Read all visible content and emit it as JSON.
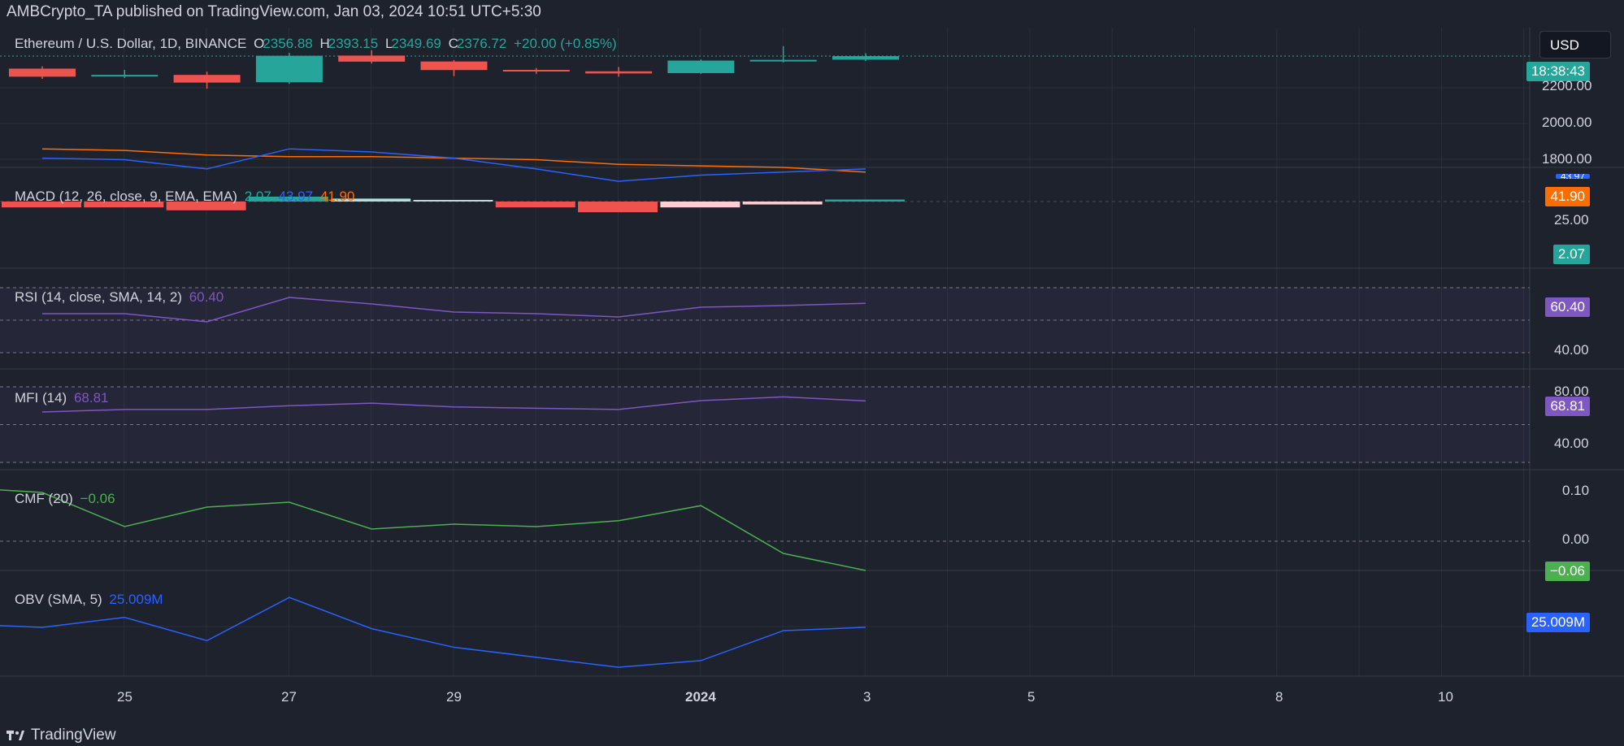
{
  "header": {
    "text": "AMBCrypto_TA published on TradingView.com, Jan 03, 2024 10:51 UTC+5:30"
  },
  "footer": {
    "logo": "TradingView"
  },
  "currency_button": "USD",
  "main": {
    "symbol": "Ethereum / U.S. Dollar, 1D, BINANCE",
    "o_key": "O",
    "o_val": "2356.88",
    "h_key": "H",
    "h_val": "2393.15",
    "l_key": "L",
    "l_val": "2349.69",
    "c_key": "C",
    "c_val": "2376.72",
    "change": "+20.00 (+0.85%)",
    "countdown": "18:38:43",
    "axis_labels": [
      "2200.00",
      "2000.00",
      "1800.00"
    ]
  },
  "macd": {
    "label": "MACD (12, 26, close, 9, EMA, EMA)",
    "v1": "2.07",
    "v2": "43.97",
    "v3": "41.90",
    "box_orange": "41.90",
    "box_blue": "43.97",
    "box_hist": "2.07",
    "axis": "25.00"
  },
  "rsi": {
    "label": "RSI (14, close, SMA, 14, 2)",
    "value": "60.40",
    "axis": "40.00"
  },
  "mfi": {
    "label": "MFI (14)",
    "value": "68.81",
    "axis_top": "80.00",
    "axis": "40.00"
  },
  "cmf": {
    "label": "CMF (20)",
    "value": "−0.06",
    "axis_top": "0.10",
    "axis_mid": "0.00"
  },
  "obv": {
    "label": "OBV (SMA, 5)",
    "value": "25.009M"
  },
  "x_axis": {
    "ticks": [
      "25",
      "27",
      "29",
      "2024",
      "3",
      "5",
      "8",
      "10"
    ]
  },
  "colors": {
    "up": "#26a69a",
    "down": "#ef5350",
    "macd": "#2962ff",
    "signal": "#ff6d00",
    "rsi": "#7e57c2",
    "cmf": "#4caf50",
    "obv": "#2962ff"
  },
  "chart_data": [
    {
      "type": "candlestick",
      "title": "Ethereum / U.S. Dollar, 1D, BINANCE",
      "x": [
        "Dec 24",
        "Dec 25",
        "Dec 26",
        "Dec 27",
        "Dec 28",
        "Dec 29",
        "Dec 30",
        "Dec 31",
        "Jan 1",
        "Jan 2",
        "Jan 3"
      ],
      "open": [
        2307,
        2267,
        2272,
        2231,
        2380,
        2347,
        2300,
        2292,
        2282,
        2354,
        2357
      ],
      "close": [
        2262,
        2272,
        2229,
        2379,
        2346,
        2299,
        2292,
        2280,
        2352,
        2356,
        2377
      ],
      "high": [
        2320,
        2300,
        2290,
        2395,
        2410,
        2355,
        2310,
        2316,
        2358,
        2433,
        2393
      ],
      "low": [
        2250,
        2255,
        2195,
        2222,
        2336,
        2265,
        2278,
        2262,
        2278,
        2342,
        2350
      ],
      "y_ticks": [
        2200,
        2000,
        1800
      ]
    },
    {
      "type": "line",
      "title": "MACD (12, 26, close, 9, EMA, EMA)",
      "x": [
        "Dec 24",
        "Dec 25",
        "Dec 26",
        "Dec 27",
        "Dec 28",
        "Dec 29",
        "Dec 30",
        "Dec 31",
        "Jan 1",
        "Jan 2",
        "Jan 3"
      ],
      "series": [
        {
          "name": "MACD",
          "values": [
            51,
            50,
            44,
            57,
            55,
            51,
            44,
            36,
            40,
            42,
            44
          ]
        },
        {
          "name": "Signal",
          "values": [
            57,
            56,
            53,
            52,
            52,
            51,
            50,
            47,
            46,
            45,
            42
          ]
        }
      ],
      "histogram": [
        -6,
        -6,
        -9,
        5,
        3,
        0,
        -6,
        -11,
        -6,
        -3,
        2.07
      ]
    },
    {
      "type": "line",
      "title": "RSI (14, close, SMA, 14, 2)",
      "x": [
        "Dec 24",
        "Dec 25",
        "Dec 26",
        "Dec 27",
        "Dec 28",
        "Dec 29",
        "Dec 30",
        "Dec 31",
        "Jan 1",
        "Jan 2",
        "Jan 3"
      ],
      "series": [
        {
          "name": "RSI",
          "values": [
            54,
            54,
            49,
            64,
            60,
            55,
            54,
            52,
            58,
            59,
            60.4
          ]
        }
      ],
      "bands": [
        70,
        50,
        30
      ]
    },
    {
      "type": "line",
      "title": "MFI (14)",
      "x": [
        "Dec 24",
        "Dec 25",
        "Dec 26",
        "Dec 27",
        "Dec 28",
        "Dec 29",
        "Dec 30",
        "Dec 31",
        "Jan 1",
        "Jan 2",
        "Jan 3"
      ],
      "series": [
        {
          "name": "MFI",
          "values": [
            60,
            62,
            62,
            65,
            67,
            64,
            63,
            62,
            69,
            72,
            68.81
          ]
        }
      ],
      "bands": [
        80,
        50,
        20
      ]
    },
    {
      "type": "line",
      "title": "CMF (20)",
      "x": [
        "Dec 23",
        "Dec 24",
        "Dec 25",
        "Dec 26",
        "Dec 27",
        "Dec 28",
        "Dec 29",
        "Dec 30",
        "Dec 31",
        "Jan 1",
        "Jan 2",
        "Jan 3"
      ],
      "series": [
        {
          "name": "CMF",
          "values": [
            0.11,
            0.1,
            0.03,
            0.07,
            0.08,
            0.025,
            0.035,
            0.03,
            0.042,
            0.073,
            -0.025,
            -0.06
          ]
        }
      ],
      "zero_line": 0
    },
    {
      "type": "line",
      "title": "OBV (SMA, 5)",
      "x": [
        "Dec 23",
        "Dec 24",
        "Dec 25",
        "Dec 26",
        "Dec 27",
        "Dec 28",
        "Dec 29",
        "Dec 30",
        "Dec 31",
        "Jan 1",
        "Jan 2",
        "Jan 3"
      ],
      "series": [
        {
          "name": "OBV",
          "values": [
            25.5,
            25.0,
            26.5,
            23.0,
            29.5,
            24.8,
            22.0,
            20.5,
            19.0,
            20.0,
            24.5,
            25.009
          ]
        }
      ]
    }
  ]
}
